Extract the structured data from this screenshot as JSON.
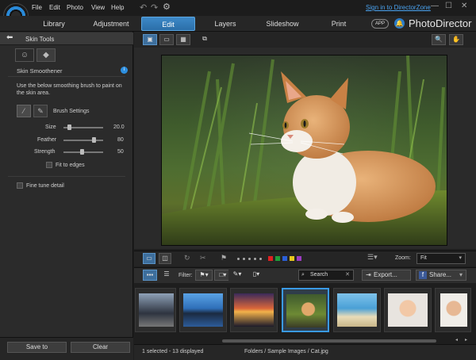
{
  "titlebar": {
    "menu": [
      "File",
      "Edit",
      "Photo",
      "View",
      "Help"
    ],
    "sign_in": "Sign in to DirectorZone",
    "window_controls": {
      "minimize": "—",
      "maximize": "☐",
      "close": "✕"
    }
  },
  "modes": {
    "tabs": [
      "Library",
      "Adjustment",
      "Edit",
      "Layers",
      "Slideshow",
      "Print"
    ],
    "active": "Edit",
    "app_badge": "APP",
    "brand": "PhotoDirector"
  },
  "left_panel": {
    "header": "Skin Tools",
    "section_title": "Skin Smoothener",
    "description": "Use the below smoothing brush to paint on the skin area.",
    "brush_settings_label": "Brush Settings",
    "sliders": [
      {
        "label": "Size",
        "value": "20.0",
        "level": 0.2
      },
      {
        "label": "Feather",
        "value": "80",
        "level": 0.8
      },
      {
        "label": "Strength",
        "value": "50",
        "level": 0.5
      }
    ],
    "fit_to_edges_label": "Fit to edges",
    "fine_tune_label": "Fine tune detail",
    "save_to_label": "Save to",
    "clear_label": "Clear"
  },
  "viewer": {
    "zoom_label": "Zoom:",
    "zoom_value": "Fit",
    "color_labels": [
      "#e02020",
      "#1f9e3a",
      "#2b5fd8",
      "#e8c81c",
      "#9b3cc0"
    ]
  },
  "browser": {
    "filter_label": "Filter:",
    "search_placeholder": "Search",
    "export_label": "Export...",
    "share_label": "Share..."
  },
  "status": {
    "selection": "1 selected - 13 displayed",
    "path": "Folders / Sample Images / Cat.jpg"
  },
  "colors": {
    "accent": "#2b7bc8",
    "panel_bg": "#2b2b2b",
    "info_blue": "#2d8fe0"
  }
}
